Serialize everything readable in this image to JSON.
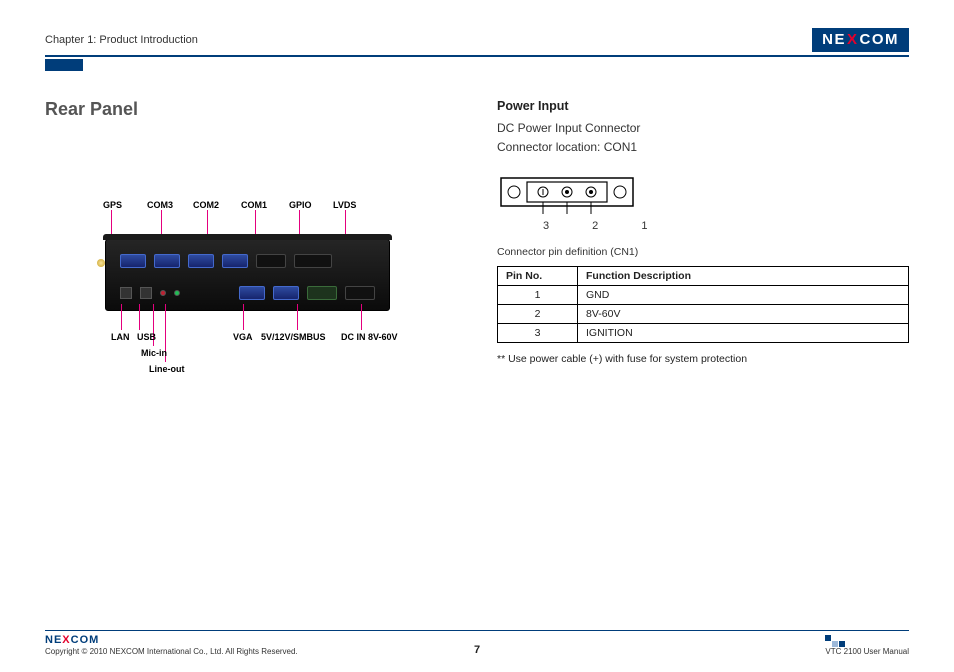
{
  "header": {
    "chapter": "Chapter 1: Product Introduction",
    "logo_pre": "NE",
    "logo_x": "X",
    "logo_post": "COM"
  },
  "left": {
    "title": "Rear Panel",
    "labels_top": {
      "gps": "GPS",
      "com3": "COM3",
      "com2": "COM2",
      "com1": "COM1",
      "gpio": "GPIO",
      "lvds": "LVDS"
    },
    "labels_bottom": {
      "lan": "LAN",
      "usb": "USB",
      "mic": "Mic-in",
      "lineout": "Line-out",
      "vga": "VGA",
      "smbus": "5V/12V/SMBUS",
      "dcin": "DC IN 8V-60V"
    }
  },
  "right": {
    "title": "Power Input",
    "line1": "DC Power Input Connector",
    "line2": "Connector location: CON1",
    "pin_nums": "3 2 1",
    "note": "Connector pin definition (CN1)",
    "th1": "Pin  No.",
    "th2": "Function Description",
    "rows": [
      {
        "pin": "1",
        "fn": "GND"
      },
      {
        "pin": "2",
        "fn": "8V-60V"
      },
      {
        "pin": "3",
        "fn": "IGNITION"
      }
    ],
    "footnote": "** Use power cable (+) with fuse for system protection"
  },
  "footer": {
    "logo_pre": "NE",
    "logo_x": "X",
    "logo_post": "COM",
    "copyright": "Copyright © 2010 NEXCOM International Co., Ltd. All Rights Reserved.",
    "page": "7",
    "manual": "VTC 2100 User Manual"
  }
}
